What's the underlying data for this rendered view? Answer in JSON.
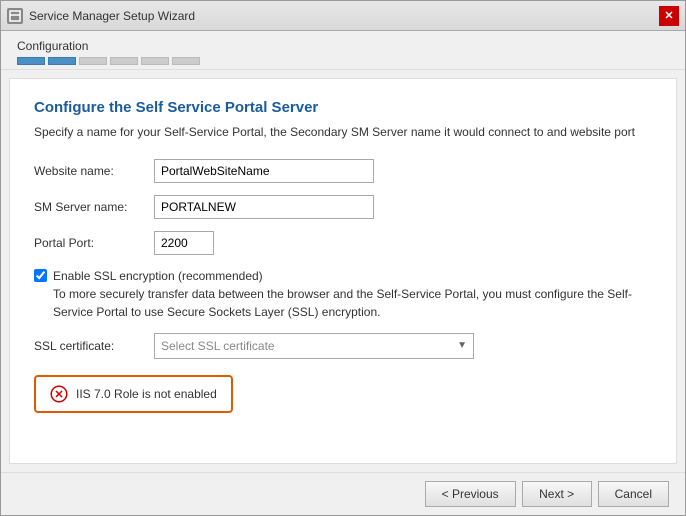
{
  "window": {
    "title": "Service Manager Setup Wizard",
    "close_label": "✕"
  },
  "progress": {
    "label": "Configuration",
    "steps": [
      {
        "active": true
      },
      {
        "active": true
      },
      {
        "active": false
      },
      {
        "active": false
      },
      {
        "active": false
      },
      {
        "active": false
      }
    ]
  },
  "section": {
    "title": "Configure the Self Service Portal Server",
    "description": "Specify a name for your Self-Service Portal, the Secondary SM Server name it would connect to and website port"
  },
  "form": {
    "website_name_label": "Website name:",
    "website_name_value": "PortalWebSiteName",
    "sm_server_label": "SM Server name:",
    "sm_server_value": "PORTALNEW",
    "portal_port_label": "Portal Port:",
    "portal_port_value": "2200",
    "ssl_checkbox_label": "Enable SSL encryption (recommended)",
    "ssl_desc": "To more securely transfer data between the browser and the Self-Service Portal, you must configure the Self-Service Portal to use Secure Sockets Layer (SSL) encryption.",
    "ssl_cert_label": "SSL certificate:",
    "ssl_cert_placeholder": "Select SSL certificate"
  },
  "error": {
    "message": "IIS 7.0 Role is not enabled"
  },
  "footer": {
    "previous_label": "< Previous",
    "next_label": "Next >",
    "cancel_label": "Cancel"
  }
}
